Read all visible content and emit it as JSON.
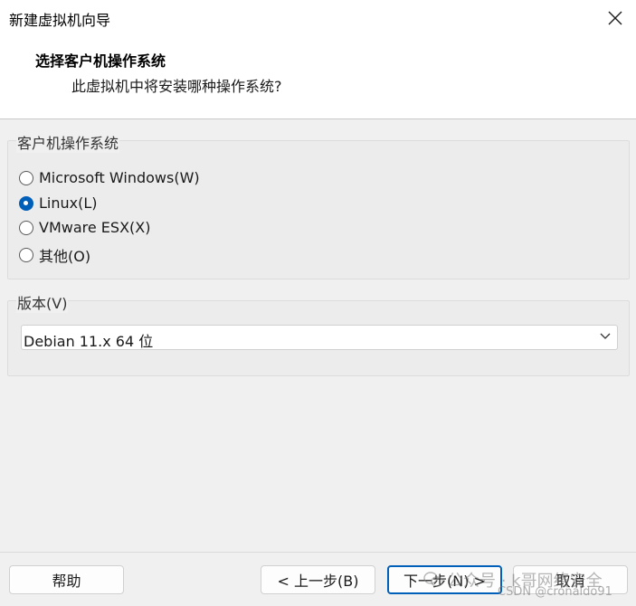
{
  "window": {
    "title": "新建虚拟机向导"
  },
  "header": {
    "title": "选择客户机操作系统",
    "subtitle": "此虚拟机中将安装哪种操作系统?"
  },
  "guest_os": {
    "legend": "客户机操作系统",
    "options": [
      {
        "label": "Microsoft Windows(W)",
        "checked": false
      },
      {
        "label": "Linux(L)",
        "checked": true
      },
      {
        "label": "VMware ESX(X)",
        "checked": false
      },
      {
        "label": "其他(O)",
        "checked": false
      }
    ]
  },
  "version": {
    "legend": "版本(V)",
    "selected": "Debian 11.x 64 位"
  },
  "footer": {
    "help_label": "帮助",
    "back_label": "< 上一步(B)",
    "next_label": "下一步(N) >",
    "cancel_label": "取消"
  },
  "watermark": {
    "line1": "公众号 · k哥网络安全",
    "line2": "CSDN @cronaldo91"
  },
  "colors": {
    "accent": "#005fb8"
  }
}
